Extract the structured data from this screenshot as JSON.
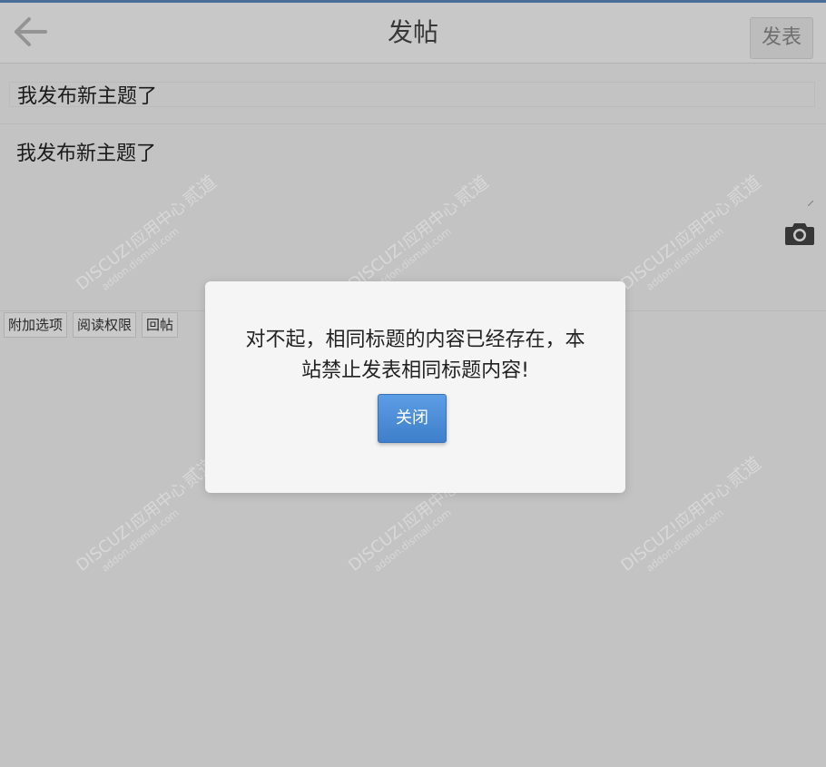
{
  "header": {
    "back_icon": "arrow-left-icon",
    "title": "发帖",
    "publish_label": "发表"
  },
  "form": {
    "subject_value": "我发布新主题了",
    "message_value": "我发布新主题了",
    "camera_icon": "camera-icon"
  },
  "tabs": [
    {
      "label": "附加选项"
    },
    {
      "label": "阅读权限"
    },
    {
      "label": "回帖"
    }
  ],
  "dialog": {
    "message_line1": "对不起，相同标题的内容已经存在，本",
    "message_line2": "站禁止发表相同标题内容!",
    "close_label": "关闭"
  },
  "watermark": {
    "brand": "DISCUZ!应用中心",
    "domain": "addon.dismall.com",
    "sub": "贰道"
  },
  "colors": {
    "accent_line": "#5a86b8",
    "button_blue": "#4a8ad6"
  }
}
